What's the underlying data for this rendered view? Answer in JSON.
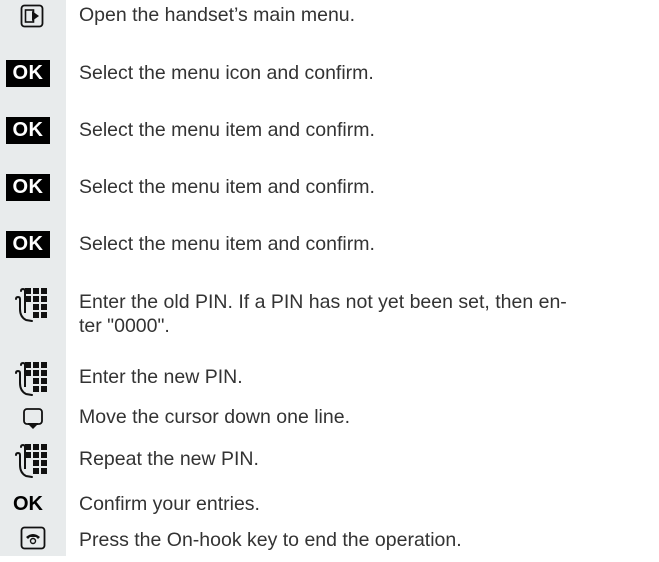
{
  "steps": [
    {
      "icon": "menu-key-icon",
      "text": "Open the handset’s main menu."
    },
    {
      "icon": "ok-key",
      "key_label": "OK",
      "text": "Select the menu icon and confirm."
    },
    {
      "icon": "ok-key",
      "key_label": "OK",
      "text": "Select the menu item and confirm."
    },
    {
      "icon": "ok-key",
      "key_label": "OK",
      "text": "Select the menu item and confirm."
    },
    {
      "icon": "ok-key",
      "key_label": "OK",
      "text": "Select the menu item and confirm."
    },
    {
      "icon": "keypad-hand-icon",
      "text": "Enter the old PIN. If a PIN has not yet been set, then en-",
      "text2": "ter \"0000\"."
    },
    {
      "icon": "keypad-hand-icon",
      "text": "Enter the new PIN."
    },
    {
      "icon": "cursor-down-icon",
      "text": "Move the cursor down one line."
    },
    {
      "icon": "keypad-hand-icon",
      "text": "Repeat the new PIN."
    },
    {
      "icon": "ok-key",
      "key_label": "OK",
      "text": "Confirm your entries."
    },
    {
      "icon": "on-hook-key-icon",
      "text": "Press the On-hook key to end the operation."
    }
  ]
}
